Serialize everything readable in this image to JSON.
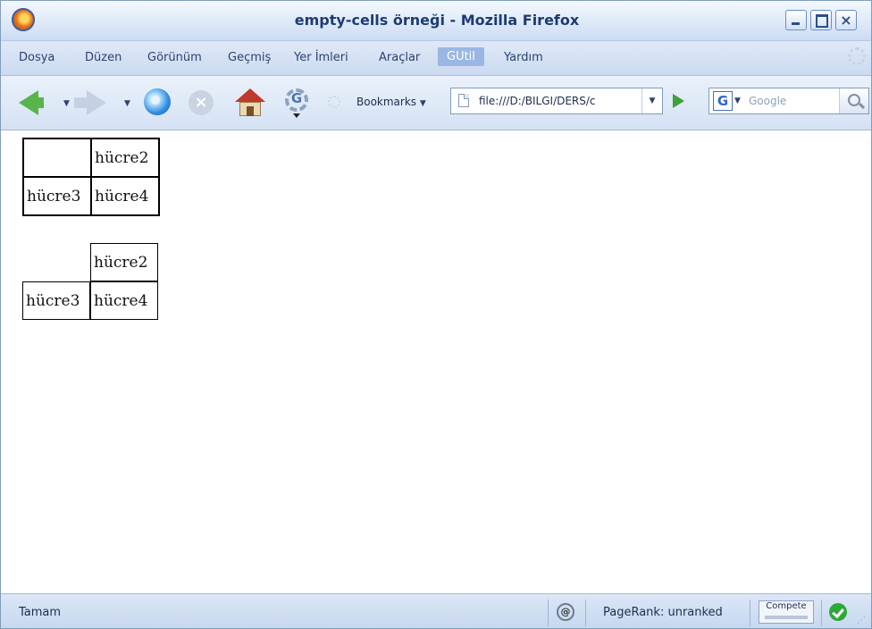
{
  "window": {
    "title": "empty-cells örneği - Mozilla Firefox"
  },
  "menu": {
    "items": [
      "Dosya",
      "Düzen",
      "Görünüm",
      "Geçmiş",
      "Yer İmleri",
      "Araçlar",
      "GUtil",
      "Yardım"
    ],
    "active_item": "GUtil"
  },
  "toolbar": {
    "bookmarks_label": "Bookmarks",
    "url": "file:///D:/BILGI/DERS/c",
    "search_placeholder": "Google",
    "search_engine_letter": "G"
  },
  "content": {
    "table1": {
      "row1": [
        "",
        "hücre2"
      ],
      "row2": [
        "hücre3",
        "hücre4"
      ]
    },
    "table2": {
      "row1": [
        "",
        "hücre2"
      ],
      "row2": [
        "hücre3",
        "hücre4"
      ]
    }
  },
  "statusbar": {
    "status": "Tamam",
    "pagerank": "PageRank: unranked",
    "compete_label": "Compete"
  },
  "icons": {
    "app": "firefox-icon",
    "back": "back-arrow-icon",
    "forward": "forward-arrow-icon",
    "reload": "reload-icon",
    "stop": "stop-icon",
    "home": "home-icon",
    "go": "go-arrow-icon",
    "search": "magnifier-icon",
    "status_ok": "check-icon"
  },
  "colors": {
    "accent": "#9ab7e4",
    "title_text": "#1d3c72",
    "back_arrow": "#57b54a"
  }
}
